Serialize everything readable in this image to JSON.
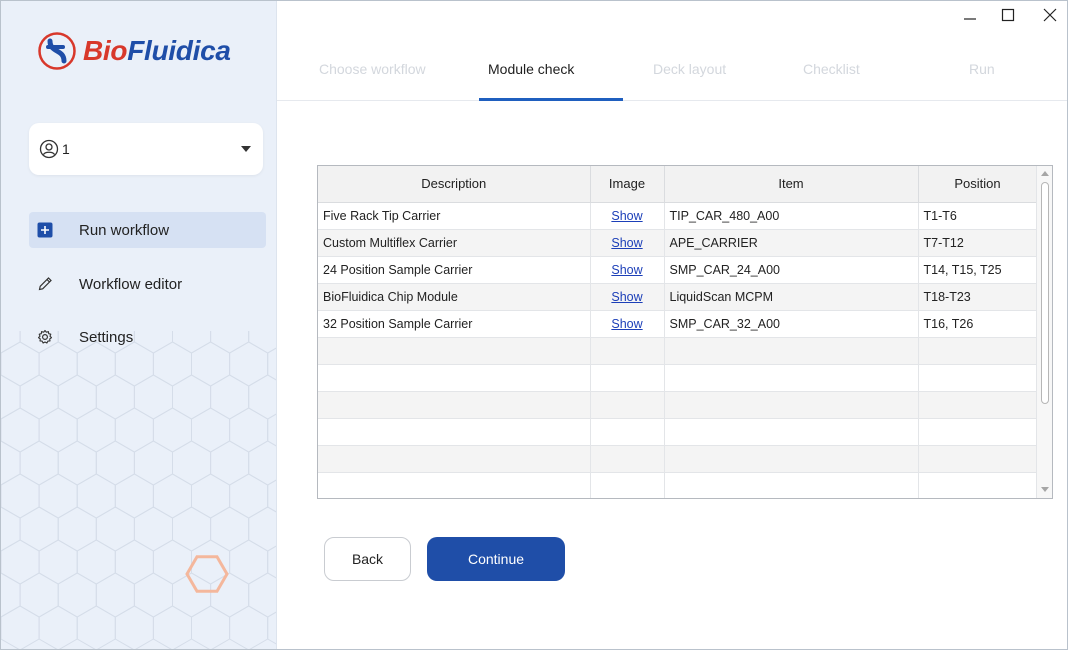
{
  "app": {
    "logo_bio": "Bio",
    "logo_fluidica": "Fluidica",
    "brand_colors": {
      "red": "#d8382b",
      "blue": "#1f4ea8"
    }
  },
  "window_controls": {
    "minimize_icon": "minimize-icon",
    "maximize_icon": "maximize-icon",
    "close_icon": "close-icon"
  },
  "user": {
    "name": "1",
    "icon": "user-circle-icon"
  },
  "sidebar": {
    "items": [
      {
        "label": "Run workflow",
        "icon": "plus-square-icon",
        "active": true
      },
      {
        "label": "Workflow editor",
        "icon": "pencil-icon",
        "active": false
      },
      {
        "label": "Settings",
        "icon": "gear-icon",
        "active": false
      }
    ]
  },
  "steps": [
    {
      "label": "Choose workflow",
      "active": false
    },
    {
      "label": "Module check",
      "active": true
    },
    {
      "label": "Deck layout",
      "active": false
    },
    {
      "label": "Checklist",
      "active": false
    },
    {
      "label": "Run",
      "active": false
    }
  ],
  "table": {
    "headers": [
      "Description",
      "Image",
      "Item",
      "Position"
    ],
    "rows": [
      {
        "description": "Five Rack Tip Carrier",
        "image": "Show",
        "item": "TIP_CAR_480_A00",
        "position": "T1-T6"
      },
      {
        "description": "Custom Multiflex Carrier",
        "image": "Show",
        "item": "APE_CARRIER",
        "position": "T7-T12"
      },
      {
        "description": "24 Position Sample Carrier",
        "image": "Show",
        "item": "SMP_CAR_24_A00",
        "position": "T14, T15, T25"
      },
      {
        "description": "BioFluidica Chip Module",
        "image": "Show",
        "item": "LiquidScan MCPM",
        "position": "T18-T23"
      },
      {
        "description": "32 Position Sample Carrier",
        "image": "Show",
        "item": "SMP_CAR_32_A00",
        "position": "T16, T26"
      }
    ],
    "empty_rows": 6
  },
  "buttons": {
    "back": "Back",
    "continue": "Continue"
  },
  "colors": {
    "accent": "#1f4ea8",
    "tab_underline": "#1f5fbf",
    "sidebar_bg": "#eaf0f9",
    "active_nav_bg": "#d6e1f3"
  }
}
